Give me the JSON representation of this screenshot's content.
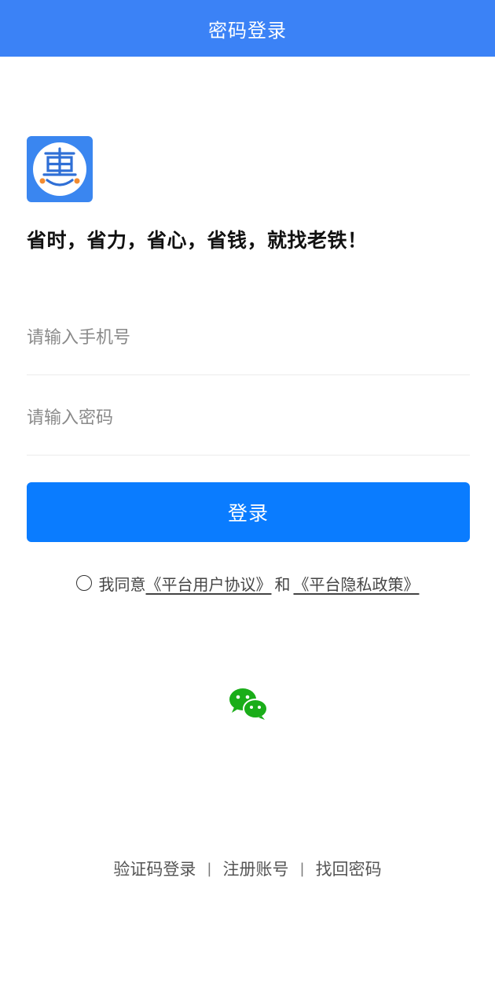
{
  "header": {
    "title": "密码登录"
  },
  "brand": {
    "slogan": "省时，省力，省心，省钱，就找老铁！",
    "logo_icon": "hui-logo-icon"
  },
  "form": {
    "phone_placeholder": "请输入手机号",
    "password_placeholder": "请输入密码",
    "login_label": "登录"
  },
  "agreement": {
    "prefix": "我同意",
    "user_agreement": "《平台用户协议》",
    "and": "和",
    "privacy_policy": "《平台隐私政策》",
    "checked": false
  },
  "social": {
    "wechat_icon": "wechat-icon"
  },
  "footer": {
    "links": [
      "验证码登录",
      "注册账号",
      "找回密码"
    ],
    "separator": "|"
  },
  "colors": {
    "header": "#3b82f6",
    "button": "#0a7cff",
    "logo_bg": "#3a86f0",
    "wechat": "#1aad19"
  }
}
